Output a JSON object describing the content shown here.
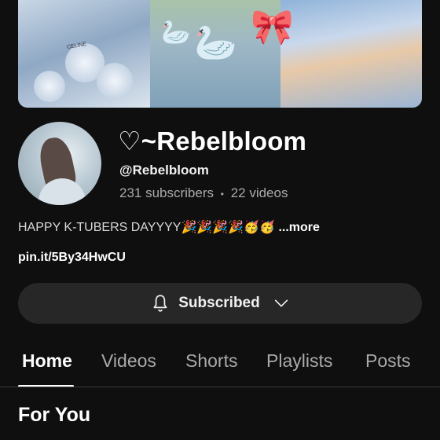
{
  "channel": {
    "name": "♡~Rebelbloom",
    "handle": "@Rebelbloom",
    "subscribers": "231 subscribers",
    "separator": "•",
    "videos": "22 videos",
    "description": "HAPPY K-TUBERS DAYYYY🎉🎉🎉🎉🥳🥳",
    "more_label": " ...more",
    "link": "pin.it/5By34HwCU"
  },
  "subscribe_button": {
    "label": "Subscribed",
    "icon": "bell-icon",
    "dropdown_icon": "chevron-down-icon"
  },
  "tabs": [
    {
      "label": "Home",
      "active": true
    },
    {
      "label": "Videos",
      "active": false
    },
    {
      "label": "Shorts",
      "active": false
    },
    {
      "label": "Playlists",
      "active": false
    },
    {
      "label": "Posts",
      "active": false
    }
  ],
  "section": {
    "title": "For You"
  },
  "banner": {
    "brand_text": "CELINE"
  },
  "colors": {
    "background": "#0f0f0f",
    "button": "#272727",
    "secondary_text": "#aaaaaa"
  }
}
